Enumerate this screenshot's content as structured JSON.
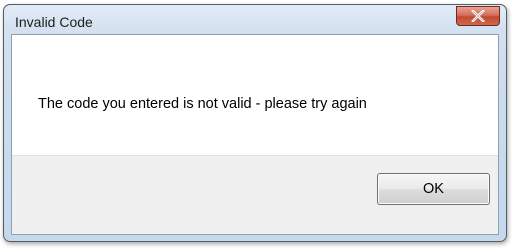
{
  "dialog": {
    "title": "Invalid Code",
    "close_icon": "close-icon",
    "message": "The code you entered is not valid - please try again",
    "ok_label": "OK"
  },
  "colors": {
    "close_button": "#c24a33",
    "title_bar": "#cbdcee",
    "footer": "#f0f0f0"
  }
}
